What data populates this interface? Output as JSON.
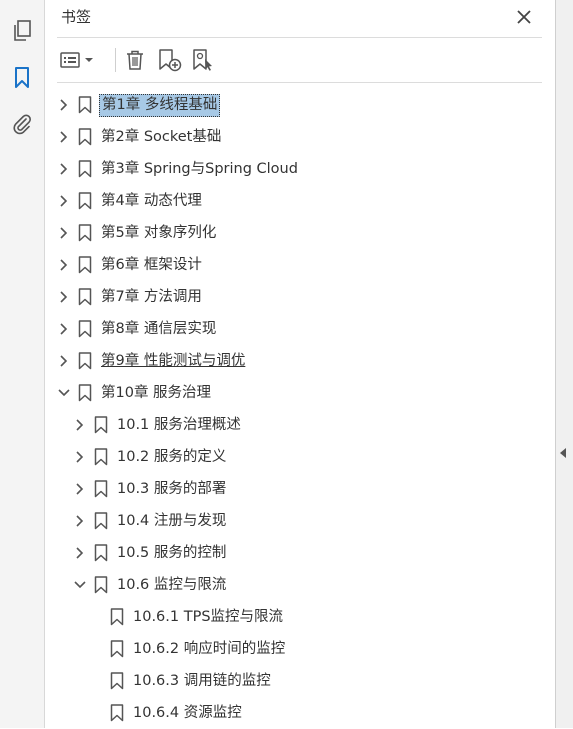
{
  "panel": {
    "title": "书签"
  },
  "icons": {
    "pages": "pages-icon",
    "bookmarks": "bookmark-icon",
    "attachments": "paperclip-icon",
    "close": "close-icon",
    "options": "options-list-icon",
    "delete": "trash-icon",
    "new_bookmark": "new-bookmark-icon",
    "bookmark_from_selection": "bookmark-select-icon"
  },
  "colors": {
    "accent": "#1a73c8",
    "selection": "#a7c9e6"
  },
  "bookmarks": [
    {
      "label": "第1章 多线程基础",
      "level": 0,
      "expanded": false,
      "has_children": true,
      "selected": true
    },
    {
      "label": "第2章 Socket基础",
      "level": 0,
      "expanded": false,
      "has_children": true
    },
    {
      "label": "第3章 Spring与Spring Cloud",
      "level": 0,
      "expanded": false,
      "has_children": true
    },
    {
      "label": "第4章 动态代理",
      "level": 0,
      "expanded": false,
      "has_children": true
    },
    {
      "label": "第5章 对象序列化",
      "level": 0,
      "expanded": false,
      "has_children": true
    },
    {
      "label": "第6章 框架设计",
      "level": 0,
      "expanded": false,
      "has_children": true
    },
    {
      "label": "第7章 方法调用",
      "level": 0,
      "expanded": false,
      "has_children": true
    },
    {
      "label": "第8章 通信层实现",
      "level": 0,
      "expanded": false,
      "has_children": true
    },
    {
      "label": "第9章 性能测试与调优",
      "level": 0,
      "expanded": false,
      "has_children": true,
      "underlined": true
    },
    {
      "label": "第10章 服务治理",
      "level": 0,
      "expanded": true,
      "has_children": true
    },
    {
      "label": "10.1 服务治理概述",
      "level": 1,
      "expanded": false,
      "has_children": true
    },
    {
      "label": "10.2 服务的定义",
      "level": 1,
      "expanded": false,
      "has_children": true
    },
    {
      "label": "10.3 服务的部署",
      "level": 1,
      "expanded": false,
      "has_children": true
    },
    {
      "label": "10.4 注册与发现",
      "level": 1,
      "expanded": false,
      "has_children": true
    },
    {
      "label": "10.5 服务的控制",
      "level": 1,
      "expanded": false,
      "has_children": true
    },
    {
      "label": "10.6 监控与限流",
      "level": 1,
      "expanded": true,
      "has_children": true
    },
    {
      "label": "10.6.1 TPS监控与限流",
      "level": 2,
      "has_children": false
    },
    {
      "label": "10.6.2 响应时间的监控",
      "level": 2,
      "has_children": false
    },
    {
      "label": "10.6.3 调用链的监控",
      "level": 2,
      "has_children": false
    },
    {
      "label": "10.6.4 资源监控",
      "level": 2,
      "has_children": false
    }
  ]
}
